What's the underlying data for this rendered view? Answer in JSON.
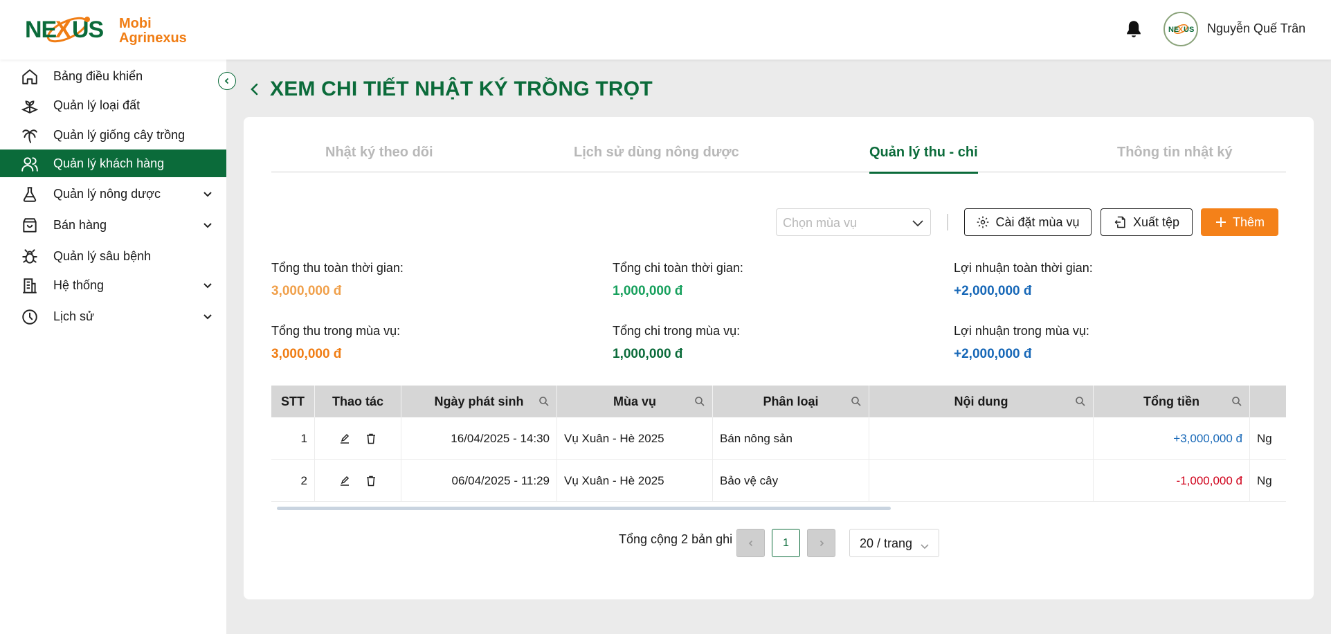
{
  "brand": {
    "line1": "Mobi",
    "line2": "Agrinexus",
    "logo_text": "NEXUS"
  },
  "user": {
    "name": "Nguyễn Quế Trân"
  },
  "sidebar": {
    "items": [
      {
        "label": "Bảng điều khiển",
        "icon": "home-icon",
        "expandable": false
      },
      {
        "label": "Quản lý loại đất",
        "icon": "soil-plant-icon",
        "expandable": false
      },
      {
        "label": "Quản lý giống cây trồng",
        "icon": "palm-tree-icon",
        "expandable": false
      },
      {
        "label": "Quản lý khách hàng",
        "icon": "users-icon",
        "expandable": false,
        "active": true
      },
      {
        "label": "Quản lý nông dược",
        "icon": "flask-icon",
        "expandable": true
      },
      {
        "label": "Bán hàng",
        "icon": "shopping-bag-icon",
        "expandable": true
      },
      {
        "label": "Quản lý sâu bệnh",
        "icon": "bug-icon",
        "expandable": false
      },
      {
        "label": "Hệ thống",
        "icon": "building-icon",
        "expandable": true
      },
      {
        "label": "Lịch sử",
        "icon": "clock-icon",
        "expandable": true
      }
    ]
  },
  "page": {
    "title": "XEM CHI TIẾT NHẬT KÝ TRỒNG TRỌT"
  },
  "tabs": [
    {
      "label": "Nhật ký theo dõi",
      "active": false
    },
    {
      "label": "Lịch sử dùng nông dược",
      "active": false
    },
    {
      "label": "Quản lý thu - chi",
      "active": true
    },
    {
      "label": "Thông tin nhật ký",
      "active": false
    }
  ],
  "toolbar": {
    "season_placeholder": "Chọn mùa vụ",
    "settings_label": "Cài đặt mùa vụ",
    "export_label": "Xuất tệp",
    "add_label": "Thêm"
  },
  "stats": {
    "total_income_all_label": "Tổng thu toàn thời gian:",
    "total_income_all_value": "3,000,000 đ",
    "total_expense_all_label": "Tổng chi toàn thời gian:",
    "total_expense_all_value": "1,000,000 đ",
    "profit_all_label": "Lợi nhuận toàn thời gian:",
    "profit_all_value": "+2,000,000 đ",
    "total_income_season_label": "Tổng thu trong mùa vụ:",
    "total_income_season_value": "3,000,000 đ",
    "total_expense_season_label": "Tổng chi trong mùa vụ:",
    "total_expense_season_value": "1,000,000 đ",
    "profit_season_label": "Lợi nhuận trong mùa vụ:",
    "profit_season_value": "+2,000,000 đ"
  },
  "colors": {
    "brand_green": "#0b6b3a",
    "accent_orange": "#f48119",
    "income_orange": "#f0a04b",
    "income_orange_dark": "#f07d14",
    "expense_green": "#17a05d",
    "expense_green_dark": "#0b6b3a",
    "profit_blue": "#1667b7",
    "negative_red": "#d0021b"
  },
  "table": {
    "columns": [
      "STT",
      "Thao tác",
      "Ngày phát sinh",
      "Mùa vụ",
      "Phân loại",
      "Nội dung",
      "Tổng tiền"
    ],
    "rows": [
      {
        "stt": "1",
        "date": "16/04/2025 - 14:30",
        "season": "Vụ Xuân - Hè 2025",
        "category": "Bán nông sản",
        "content": "",
        "amount": "+3,000,000 đ",
        "extra": "Ng"
      },
      {
        "stt": "2",
        "date": "06/04/2025 - 11:29",
        "season": "Vụ Xuân - Hè 2025",
        "category": "Bảo vệ cây",
        "content": "",
        "amount": "-1,000,000 đ",
        "extra": "Ng"
      }
    ]
  },
  "pagination": {
    "total_text": "Tổng cộng 2 bản ghi",
    "current_page": "1",
    "page_size": "20 / trang"
  }
}
